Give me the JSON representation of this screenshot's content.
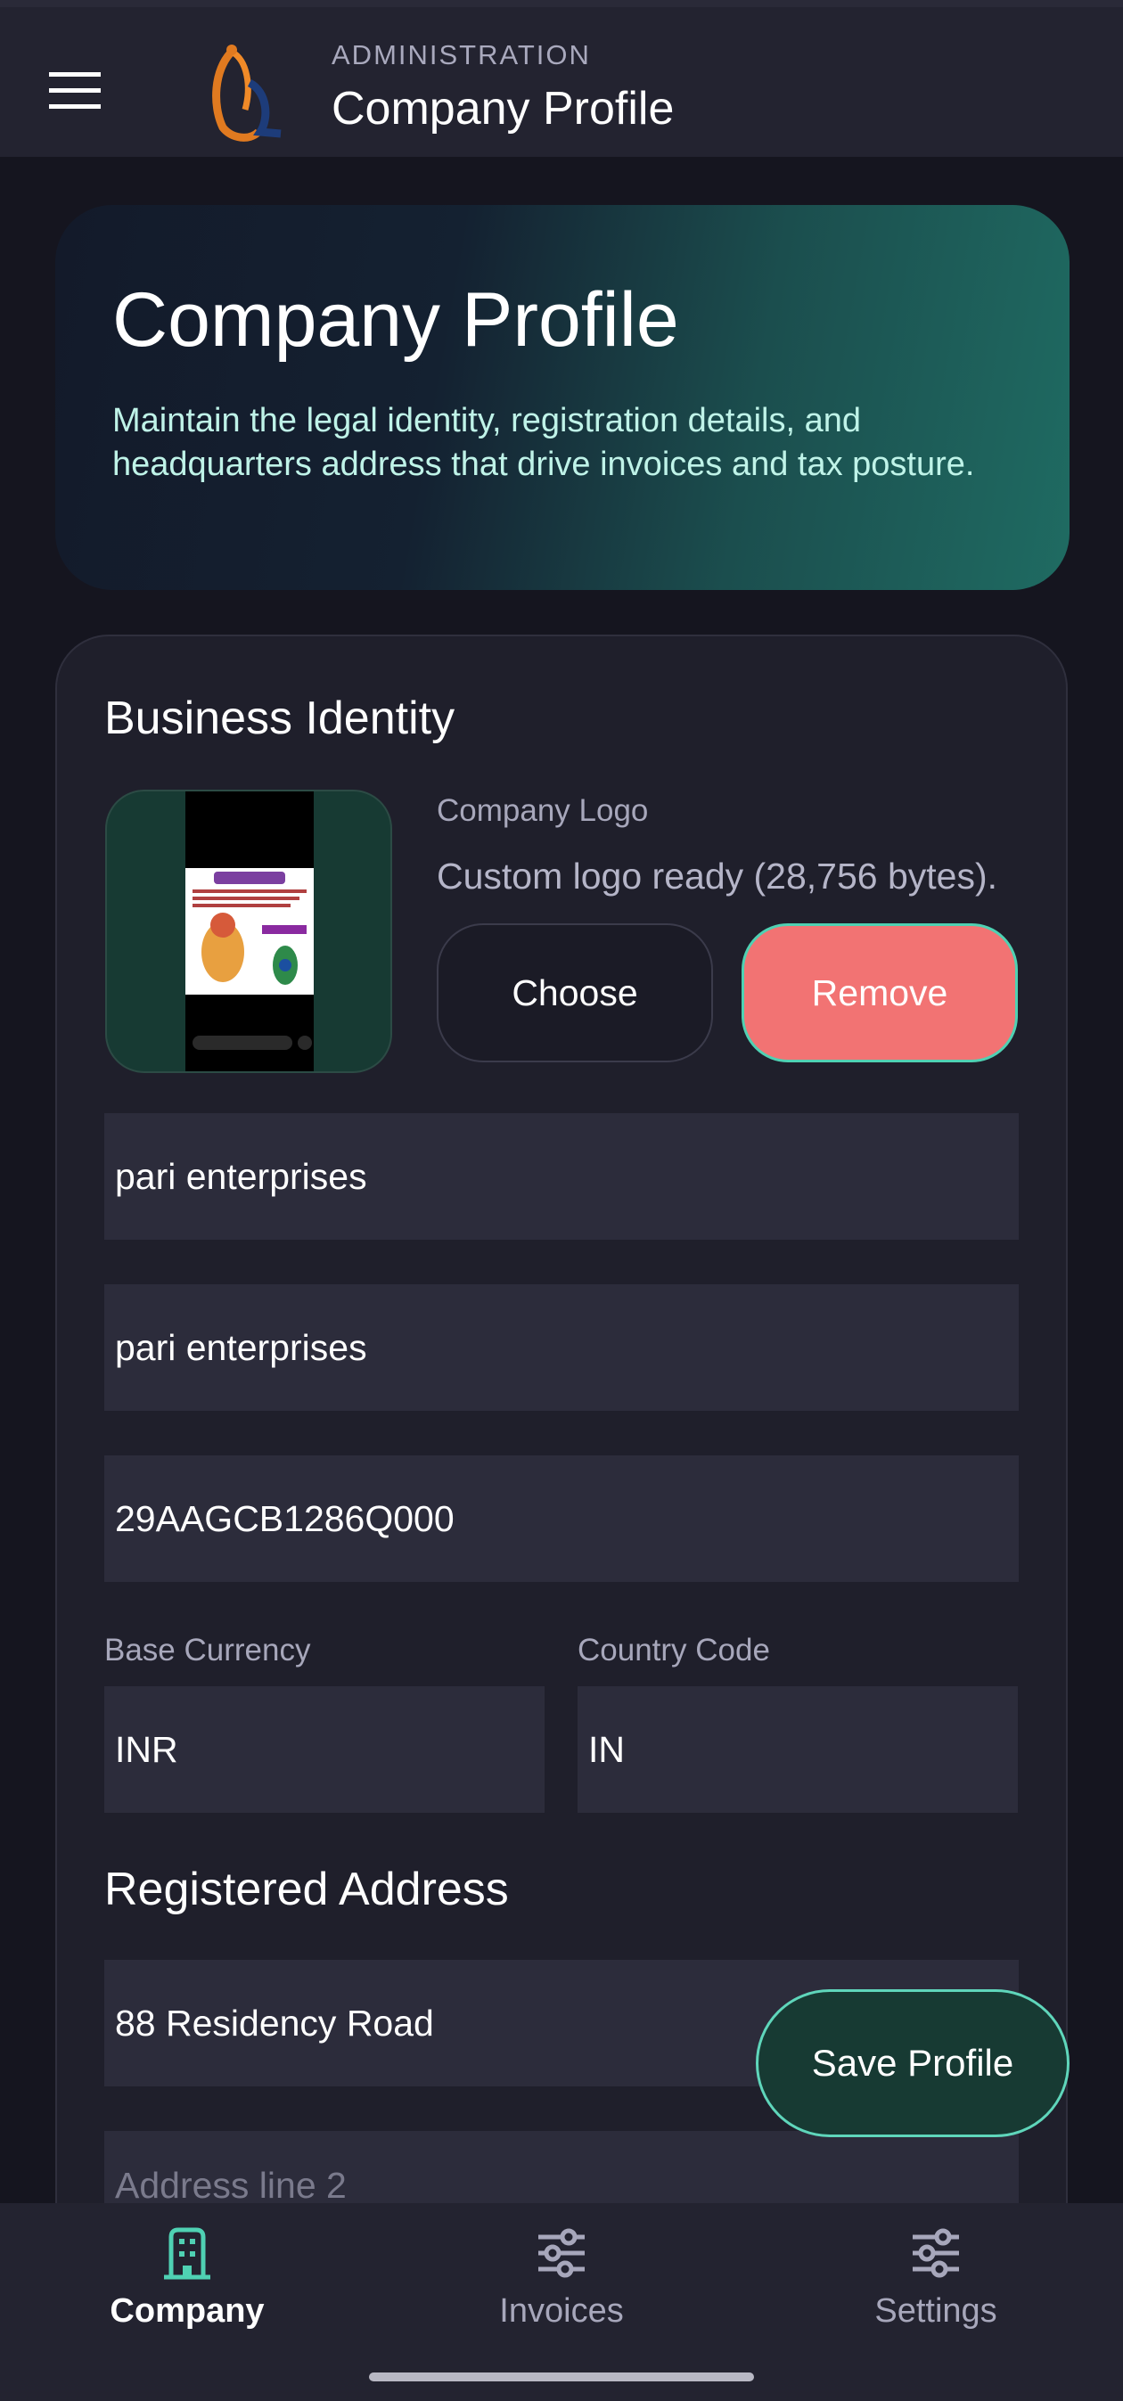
{
  "app_bar": {
    "overline": "ADMINISTRATION",
    "title": "Company Profile",
    "menu_icon": "hamburger-menu-icon",
    "logo_icon": "conch-shell-logo-icon"
  },
  "hero": {
    "title": "Company Profile",
    "description": "Maintain the legal identity, registration details, and headquarters address that drive invoices and tax posture."
  },
  "business_identity": {
    "section_title": "Business Identity",
    "logo": {
      "label": "Company Logo",
      "status": "Custom logo ready (28,756 bytes).",
      "choose_label": "Choose",
      "remove_label": "Remove"
    },
    "legal_name": "pari enterprises",
    "display_name": "pari enterprises",
    "tax_id": "29AAGCB1286Q000",
    "base_currency": {
      "label": "Base Currency",
      "value": "INR"
    },
    "country_code": {
      "label": "Country Code",
      "value": "IN"
    }
  },
  "registered_address": {
    "section_title": "Registered Address",
    "line1": "88 Residency Road",
    "line2_placeholder": "Address line 2"
  },
  "save_button_label": "Save Profile",
  "bottom_nav": {
    "items": [
      {
        "label": "Company",
        "icon": "building-icon",
        "active": true
      },
      {
        "label": "Invoices",
        "icon": "sliders-icon",
        "active": false
      },
      {
        "label": "Settings",
        "icon": "sliders-icon",
        "active": false
      }
    ]
  },
  "colors": {
    "background": "#15151f",
    "surface": "#232330",
    "accent": "#4fd1b3",
    "danger": "#f27373"
  }
}
